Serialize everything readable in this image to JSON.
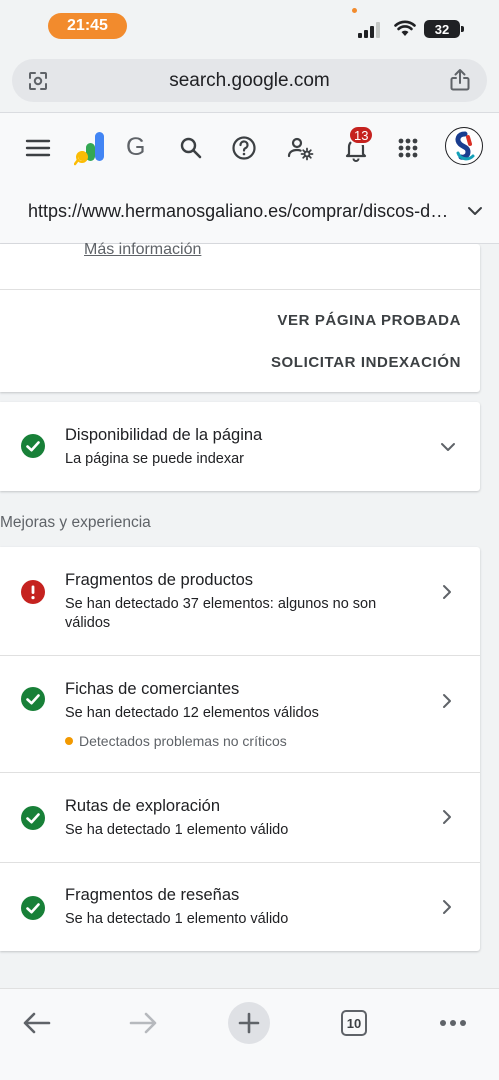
{
  "status_bar": {
    "time": "21:45",
    "battery": "32",
    "accent_color": "#f28b2d"
  },
  "browser": {
    "url_domain": "search.google.com",
    "left_icon": "lens-scan-icon",
    "right_icon": "share-icon"
  },
  "header": {
    "logo_letter": "G",
    "notification_count": "13",
    "icons": [
      "menu-icon",
      "search-console-logo",
      "search-icon",
      "help-icon",
      "manage-users-icon",
      "notifications-icon",
      "apps-grid-icon",
      "account-avatar"
    ]
  },
  "inspection": {
    "url": "https://www.hermanosgaliano.es/comprar/discos-de-freno"
  },
  "top_card": {
    "more_info": "Más información",
    "view_tested_page": "VER PÁGINA PROBADA",
    "request_indexing": "SOLICITAR INDEXACIÓN"
  },
  "availability": {
    "title": "Disponibilidad de la página",
    "subtitle": "La página se puede indexar",
    "status": "valid"
  },
  "enhancements": {
    "section_label": "Mejoras y experiencia",
    "items": [
      {
        "title": "Fragmentos de productos",
        "subtitle": "Se han detectado 37 elementos: algunos no son válidos",
        "status": "error"
      },
      {
        "title": "Fichas de comerciantes",
        "subtitle": "Se han detectado 12 elementos válidos",
        "note": "Detectados problemas no críticos",
        "status": "valid"
      },
      {
        "title": "Rutas de exploración",
        "subtitle": "Se ha detectado 1 elemento válido",
        "status": "valid"
      },
      {
        "title": "Fragmentos de reseñas",
        "subtitle": "Se ha detectado 1 elemento válido",
        "status": "valid"
      }
    ]
  },
  "colors": {
    "valid_green": "#188038",
    "error_red": "#c5221f",
    "warning_orange": "#f29900"
  },
  "toolbar": {
    "tab_count": "10",
    "buttons": [
      "back-icon",
      "forward-icon",
      "new-tab-icon",
      "tab-switcher-icon",
      "more-icon"
    ]
  }
}
